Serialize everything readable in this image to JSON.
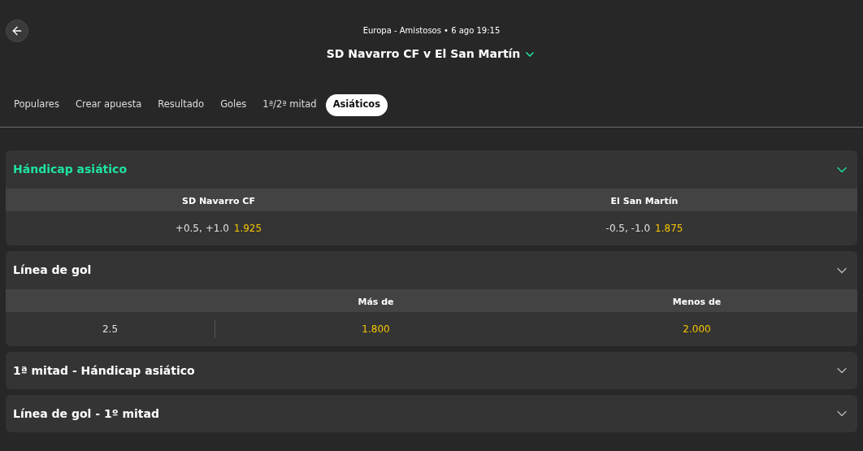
{
  "event": {
    "subtitle": "Europa - Amistosos • 6 ago 19:15",
    "title": "SD Navarro CF v El San Martín"
  },
  "tabs": [
    {
      "label": "Populares",
      "selected": false
    },
    {
      "label": "Crear apuesta",
      "selected": false
    },
    {
      "label": "Resultado",
      "selected": false
    },
    {
      "label": "Goles",
      "selected": false
    },
    {
      "label": "1ª/2ª mitad",
      "selected": false
    },
    {
      "label": "Asiáticos",
      "selected": true
    }
  ],
  "markets": [
    {
      "title": "Hándicap asiático",
      "highlighted": true,
      "expanded": true,
      "kind": "handicap",
      "columns": [
        "SD Navarro CF",
        "El San Martín"
      ],
      "rows": [
        [
          {
            "line": "+0.5, +1.0",
            "odds": "1.925"
          },
          {
            "line": "-0.5, -1.0",
            "odds": "1.875"
          }
        ]
      ]
    },
    {
      "title": "Línea de gol",
      "highlighted": false,
      "expanded": true,
      "kind": "goal_line",
      "columns": [
        "Más de",
        "Menos de"
      ],
      "rows": [
        {
          "line": "2.5",
          "odds": [
            "1.800",
            "2.000"
          ]
        }
      ]
    },
    {
      "title": "1ª mitad - Hándicap asiático",
      "highlighted": false,
      "expanded": false
    },
    {
      "title": "Línea de gol - 1º mitad",
      "highlighted": false,
      "expanded": false
    }
  ]
}
